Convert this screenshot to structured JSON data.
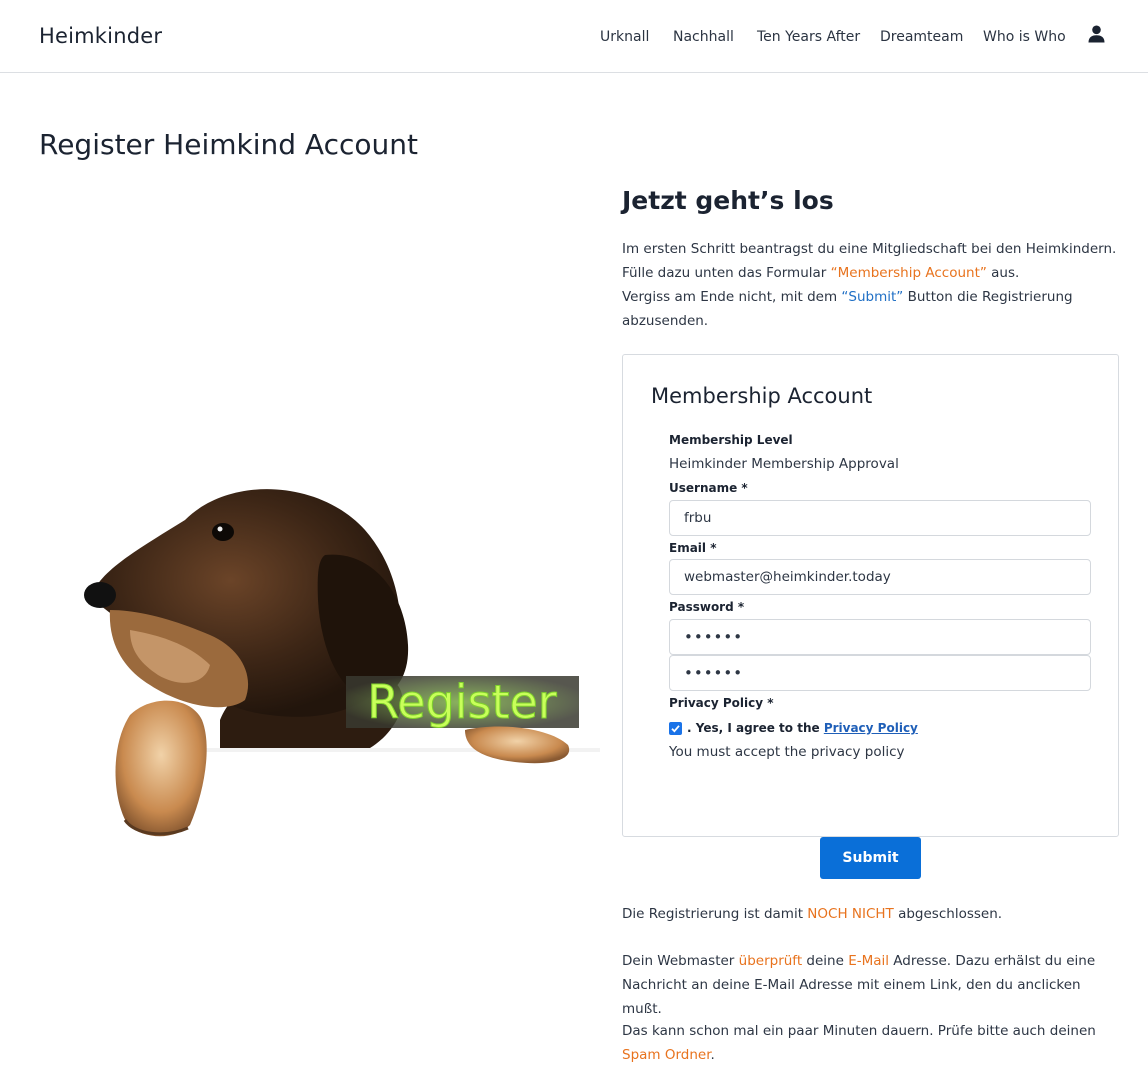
{
  "header": {
    "brand": "Heimkinder",
    "nav": [
      "Urknall",
      "Nachhall",
      "Ten Years After",
      "Dreamteam",
      "Who is Who"
    ],
    "user_icon": "user-icon"
  },
  "page_title": "Register Heimkind Account",
  "illustration": {
    "overlay_text": "Register"
  },
  "intro": {
    "title": "Jetzt geht’s los",
    "p1_a": "Im ersten Schritt beantragst du eine Mitgliedschaft bei den Heimkindern. Fülle dazu unten das Formular ",
    "p1_highlight": "“Membership Account”",
    "p1_b": " aus.",
    "p2_a": "Vergiss am Ende nicht, mit dem ",
    "p2_highlight": "“Submit”",
    "p2_b": " Button die Registrierung abzusenden."
  },
  "form": {
    "title": "Membership Account",
    "level_label": "Membership Level",
    "level_value": "Heimkinder Membership Approval",
    "username_label": "Username *",
    "username_value": "frbu",
    "email_label": "Email *",
    "email_value": "webmaster@heimkinder.today",
    "password_label": "Password *",
    "password_value": "••••••",
    "password_confirm_value": "••••••",
    "privacy_label": "Privacy Policy *",
    "privacy_checked": true,
    "privacy_text": ". Yes, I agree to the ",
    "privacy_link": "Privacy Policy",
    "privacy_note": "You must accept the privacy policy",
    "submit_label": "Submit"
  },
  "after": {
    "s1_a": "Die Registrierung ist damit ",
    "s1_highlight": "NOCH NICHT",
    "s1_b": " abgeschlossen.",
    "s2_a": "Dein Webmaster ",
    "s2_h1": "überprüft",
    "s2_b": " deine ",
    "s2_h2": "E-Mail",
    "s2_c": " Adresse. Dazu erhälst du eine Nachricht an deine E-Mail Adresse mit einem Link, den du anclicken mußt.",
    "s3_a": "Das kann schon mal ein paar Minuten dauern. Prüfe bitte auch deinen ",
    "s3_highlight": "Spam Ordner",
    "s3_b": "."
  },
  "colors": {
    "accent_orange": "#e8731e",
    "link_blue": "#1f6fc5",
    "button_blue": "#0a6fd8"
  }
}
